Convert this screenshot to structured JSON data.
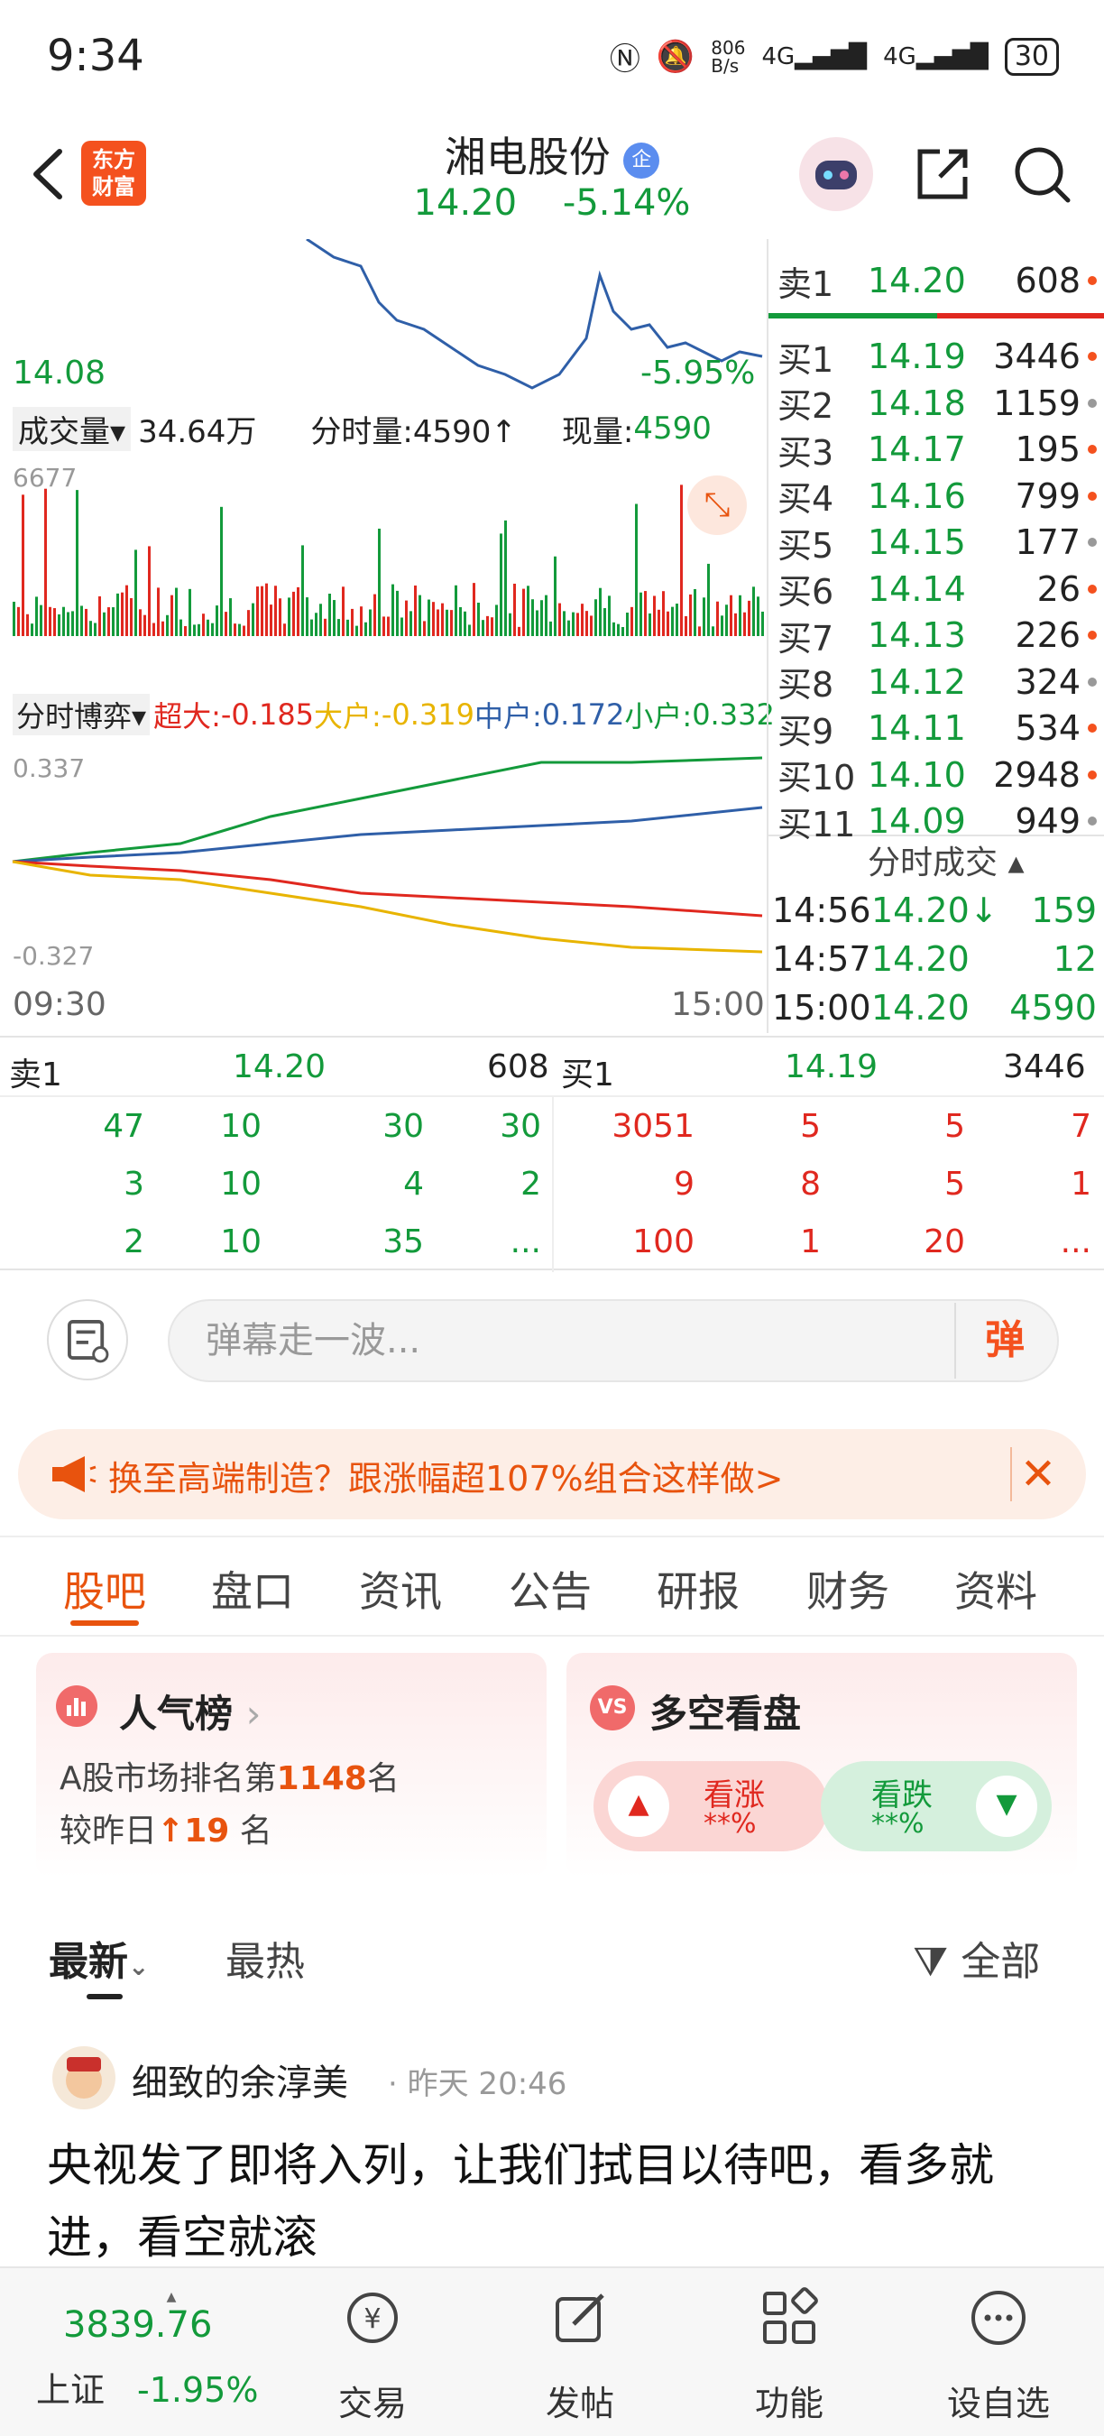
{
  "status_bar": {
    "time": "9:34",
    "net_speed": "806\nB/s",
    "signal1": "4G",
    "signal2": "4G",
    "battery": "30"
  },
  "header": {
    "logo": "东方\n财富",
    "stock_name": "湘电股份",
    "badge": "企",
    "price": "14.20",
    "change_pct": "-5.14%"
  },
  "intraday": {
    "low_price": "14.08",
    "low_pct": "-5.95%",
    "volume_selector": "成交量",
    "volume_total": "34.64万",
    "tick_volume_label": "分时量:4590",
    "current_volume_label": "现量:",
    "current_volume": "4590",
    "volume_max": "6677",
    "flow_selector": "分时博弈",
    "flow_super_label": "超大:",
    "flow_super": "-0.185",
    "flow_big_label": "大户:",
    "flow_big": "-0.319",
    "flow_mid_label": "中户:",
    "flow_mid": "0.172",
    "flow_small_label": "小户:",
    "flow_small": "0.332",
    "flow_max": "0.337",
    "flow_min": "-0.327",
    "time_start": "09:30",
    "time_end": "15:00"
  },
  "order_book": {
    "sell": [
      {
        "label": "卖1",
        "price": "14.20",
        "vol": "608"
      }
    ],
    "buy": [
      {
        "label": "买1",
        "price": "14.19",
        "vol": "3446"
      },
      {
        "label": "买2",
        "price": "14.18",
        "vol": "1159"
      },
      {
        "label": "买3",
        "price": "14.17",
        "vol": "195"
      },
      {
        "label": "买4",
        "price": "14.16",
        "vol": "799"
      },
      {
        "label": "买5",
        "price": "14.15",
        "vol": "177"
      },
      {
        "label": "买6",
        "price": "14.14",
        "vol": "26"
      },
      {
        "label": "买7",
        "price": "14.13",
        "vol": "226"
      },
      {
        "label": "买8",
        "price": "14.12",
        "vol": "324"
      },
      {
        "label": "买9",
        "price": "14.11",
        "vol": "534"
      },
      {
        "label": "买10",
        "price": "14.10",
        "vol": "2948"
      },
      {
        "label": "买11",
        "price": "14.09",
        "vol": "949"
      }
    ],
    "ticks_title": "分时成交",
    "ticks": [
      {
        "time": "14:56",
        "price": "14.20↓",
        "vol": "159"
      },
      {
        "time": "14:57",
        "price": "14.20",
        "vol": "12"
      },
      {
        "time": "15:00",
        "price": "14.20",
        "vol": "4590"
      }
    ]
  },
  "depth": {
    "ask_label": "卖1",
    "ask_price": "14.20",
    "ask_vol": "608",
    "bid_label": "买1",
    "bid_price": "14.19",
    "bid_vol": "3446",
    "ask_rows": [
      [
        "47",
        "10",
        "30",
        "30"
      ],
      [
        "3",
        "10",
        "4",
        "2"
      ],
      [
        "2",
        "10",
        "35",
        "..."
      ]
    ],
    "bid_rows": [
      [
        "3051",
        "5",
        "5",
        "7"
      ],
      [
        "9",
        "8",
        "5",
        "1"
      ],
      [
        "100",
        "1",
        "20",
        "..."
      ]
    ]
  },
  "danmaku": {
    "placeholder": "弹幕走一波...",
    "button": "弹"
  },
  "banner": {
    "text": "换至高端制造？跟涨幅超107%组合这样做>"
  },
  "tabs": [
    "股吧",
    "盘口",
    "资讯",
    "公告",
    "研报",
    "财务",
    "资料"
  ],
  "popularity": {
    "title": "人气榜",
    "rank_prefix": "A股市场排名第",
    "rank": "1148",
    "rank_suffix": "名",
    "change_prefix": "较昨日",
    "change": "19",
    "change_suffix": "名"
  },
  "sentiment": {
    "title": "多空看盘",
    "badge": "VS",
    "up_label": "看涨",
    "up_value": "**%",
    "down_label": "看跌",
    "down_value": "**%"
  },
  "feed": {
    "tab_latest": "最新",
    "tab_hot": "最热",
    "filter": "全部"
  },
  "post": {
    "author": "细致的余淳美",
    "time": "昨天 20:46",
    "body": "央视发了即将入列，让我们拭目以待吧，看多就进，看空就滚"
  },
  "bottom_nav": {
    "index_value": "3839.76",
    "index_name": "上证",
    "index_change": "-1.95%",
    "items": [
      "交易",
      "发帖",
      "功能",
      "设自选"
    ]
  }
}
